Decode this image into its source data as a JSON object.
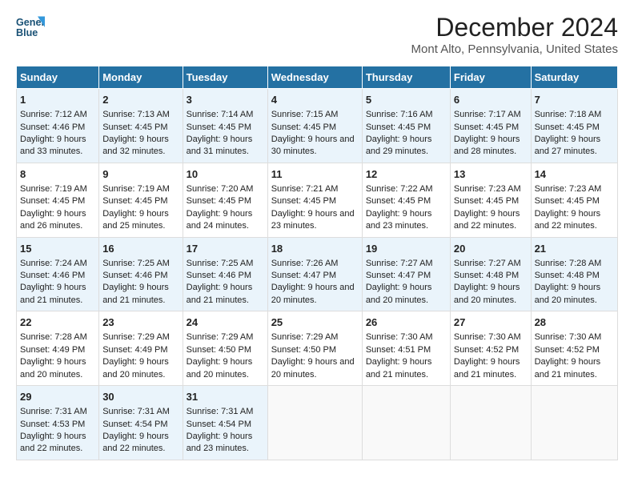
{
  "header": {
    "logo_line1": "General",
    "logo_line2": "Blue",
    "title": "December 2024",
    "subtitle": "Mont Alto, Pennsylvania, United States"
  },
  "days_of_week": [
    "Sunday",
    "Monday",
    "Tuesday",
    "Wednesday",
    "Thursday",
    "Friday",
    "Saturday"
  ],
  "weeks": [
    [
      {
        "day": 1,
        "sunrise": "7:12 AM",
        "sunset": "4:46 PM",
        "daylight": "9 hours and 33 minutes."
      },
      {
        "day": 2,
        "sunrise": "7:13 AM",
        "sunset": "4:45 PM",
        "daylight": "9 hours and 32 minutes."
      },
      {
        "day": 3,
        "sunrise": "7:14 AM",
        "sunset": "4:45 PM",
        "daylight": "9 hours and 31 minutes."
      },
      {
        "day": 4,
        "sunrise": "7:15 AM",
        "sunset": "4:45 PM",
        "daylight": "9 hours and 30 minutes."
      },
      {
        "day": 5,
        "sunrise": "7:16 AM",
        "sunset": "4:45 PM",
        "daylight": "9 hours and 29 minutes."
      },
      {
        "day": 6,
        "sunrise": "7:17 AM",
        "sunset": "4:45 PM",
        "daylight": "9 hours and 28 minutes."
      },
      {
        "day": 7,
        "sunrise": "7:18 AM",
        "sunset": "4:45 PM",
        "daylight": "9 hours and 27 minutes."
      }
    ],
    [
      {
        "day": 8,
        "sunrise": "7:19 AM",
        "sunset": "4:45 PM",
        "daylight": "9 hours and 26 minutes."
      },
      {
        "day": 9,
        "sunrise": "7:19 AM",
        "sunset": "4:45 PM",
        "daylight": "9 hours and 25 minutes."
      },
      {
        "day": 10,
        "sunrise": "7:20 AM",
        "sunset": "4:45 PM",
        "daylight": "9 hours and 24 minutes."
      },
      {
        "day": 11,
        "sunrise": "7:21 AM",
        "sunset": "4:45 PM",
        "daylight": "9 hours and 23 minutes."
      },
      {
        "day": 12,
        "sunrise": "7:22 AM",
        "sunset": "4:45 PM",
        "daylight": "9 hours and 23 minutes."
      },
      {
        "day": 13,
        "sunrise": "7:23 AM",
        "sunset": "4:45 PM",
        "daylight": "9 hours and 22 minutes."
      },
      {
        "day": 14,
        "sunrise": "7:23 AM",
        "sunset": "4:45 PM",
        "daylight": "9 hours and 22 minutes."
      }
    ],
    [
      {
        "day": 15,
        "sunrise": "7:24 AM",
        "sunset": "4:46 PM",
        "daylight": "9 hours and 21 minutes."
      },
      {
        "day": 16,
        "sunrise": "7:25 AM",
        "sunset": "4:46 PM",
        "daylight": "9 hours and 21 minutes."
      },
      {
        "day": 17,
        "sunrise": "7:25 AM",
        "sunset": "4:46 PM",
        "daylight": "9 hours and 21 minutes."
      },
      {
        "day": 18,
        "sunrise": "7:26 AM",
        "sunset": "4:47 PM",
        "daylight": "9 hours and 20 minutes."
      },
      {
        "day": 19,
        "sunrise": "7:27 AM",
        "sunset": "4:47 PM",
        "daylight": "9 hours and 20 minutes."
      },
      {
        "day": 20,
        "sunrise": "7:27 AM",
        "sunset": "4:48 PM",
        "daylight": "9 hours and 20 minutes."
      },
      {
        "day": 21,
        "sunrise": "7:28 AM",
        "sunset": "4:48 PM",
        "daylight": "9 hours and 20 minutes."
      }
    ],
    [
      {
        "day": 22,
        "sunrise": "7:28 AM",
        "sunset": "4:49 PM",
        "daylight": "9 hours and 20 minutes."
      },
      {
        "day": 23,
        "sunrise": "7:29 AM",
        "sunset": "4:49 PM",
        "daylight": "9 hours and 20 minutes."
      },
      {
        "day": 24,
        "sunrise": "7:29 AM",
        "sunset": "4:50 PM",
        "daylight": "9 hours and 20 minutes."
      },
      {
        "day": 25,
        "sunrise": "7:29 AM",
        "sunset": "4:50 PM",
        "daylight": "9 hours and 20 minutes."
      },
      {
        "day": 26,
        "sunrise": "7:30 AM",
        "sunset": "4:51 PM",
        "daylight": "9 hours and 21 minutes."
      },
      {
        "day": 27,
        "sunrise": "7:30 AM",
        "sunset": "4:52 PM",
        "daylight": "9 hours and 21 minutes."
      },
      {
        "day": 28,
        "sunrise": "7:30 AM",
        "sunset": "4:52 PM",
        "daylight": "9 hours and 21 minutes."
      }
    ],
    [
      {
        "day": 29,
        "sunrise": "7:31 AM",
        "sunset": "4:53 PM",
        "daylight": "9 hours and 22 minutes."
      },
      {
        "day": 30,
        "sunrise": "7:31 AM",
        "sunset": "4:54 PM",
        "daylight": "9 hours and 22 minutes."
      },
      {
        "day": 31,
        "sunrise": "7:31 AM",
        "sunset": "4:54 PM",
        "daylight": "9 hours and 23 minutes."
      },
      null,
      null,
      null,
      null
    ]
  ]
}
